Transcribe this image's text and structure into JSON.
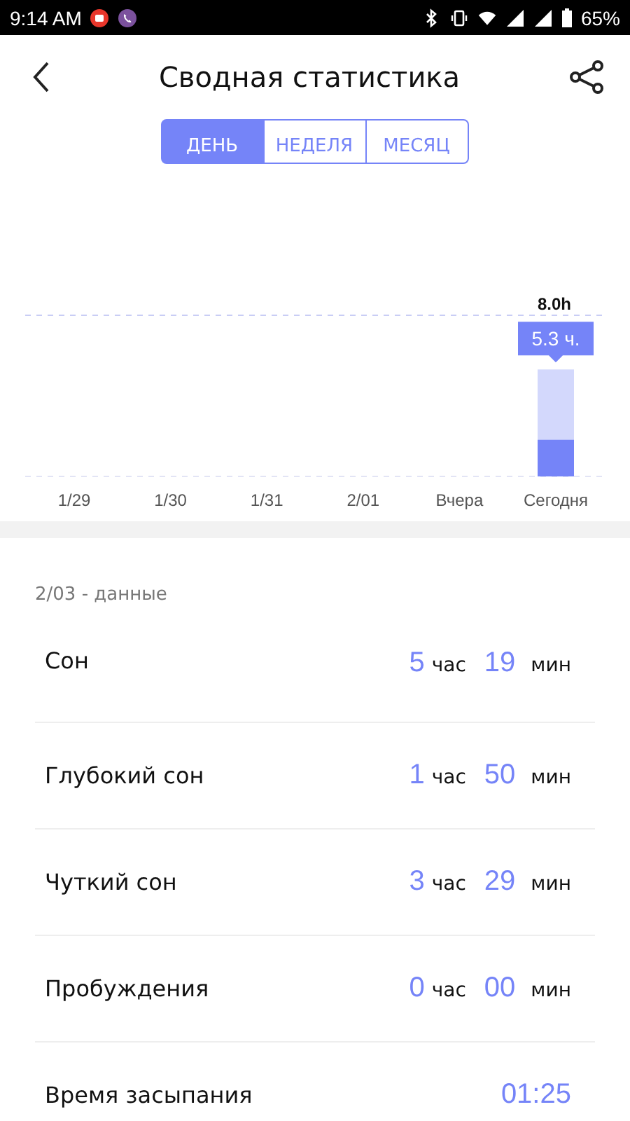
{
  "status_bar": {
    "time": "9:14 AM",
    "battery": "65%"
  },
  "header": {
    "title": "Сводная статистика"
  },
  "tabs": [
    {
      "label": "ДЕНЬ",
      "selected": true
    },
    {
      "label": "НЕДЕЛЯ",
      "selected": false
    },
    {
      "label": "МЕСЯЦ",
      "selected": false
    }
  ],
  "chart": {
    "tooltip": "5.3 ч.",
    "chart_data": {
      "type": "bar",
      "stacked": true,
      "categories": [
        "1/29",
        "1/30",
        "1/31",
        "2/01",
        "Вчера",
        "Сегодня"
      ],
      "ylim": [
        0,
        8
      ],
      "yticks": [
        {
          "value": 8,
          "label": "8.0h"
        }
      ],
      "series": [
        {
          "color": "#7584f8",
          "values": [
            null,
            null,
            null,
            null,
            null,
            1.83
          ]
        },
        {
          "color": "#d3d8fc",
          "values": [
            null,
            null,
            null,
            null,
            null,
            3.48
          ]
        }
      ]
    }
  },
  "section_title": "2/03 - данные",
  "rows": [
    {
      "kind": "duration",
      "label": "Сон",
      "parts": [
        {
          "number": "5",
          "unit": "час"
        },
        {
          "number": "19",
          "unit": "мин"
        }
      ]
    },
    {
      "kind": "duration",
      "label": "Глубокий сон",
      "parts": [
        {
          "number": "1",
          "unit": "час"
        },
        {
          "number": "50",
          "unit": "мин"
        }
      ]
    },
    {
      "kind": "duration",
      "label": "Чуткий сон",
      "parts": [
        {
          "number": "3",
          "unit": "час"
        },
        {
          "number": "29",
          "unit": "мин"
        }
      ]
    },
    {
      "kind": "duration",
      "label": "Пробуждения",
      "parts": [
        {
          "number": "0",
          "unit": "час"
        },
        {
          "number": "00",
          "unit": "мин"
        }
      ]
    },
    {
      "kind": "time",
      "label": "Время засыпания",
      "value": "01:25"
    }
  ]
}
